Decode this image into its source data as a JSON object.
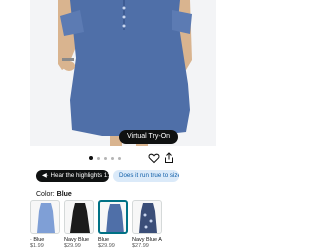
{
  "product": {
    "virtual_tryon_label": "Virtual Try-On",
    "image_count": 5,
    "active_image": 1
  },
  "actions": {
    "highlights_label": "◀· Hear the highlights 1:59",
    "fit_label": "Does it run true to size?"
  },
  "color": {
    "label": "Color:",
    "selected": "Blue"
  },
  "swatches": [
    {
      "name": "· Blue",
      "price": "$1.99",
      "color": "#7f9fd6"
    },
    {
      "name": "Navy Blue",
      "price": "$29.99",
      "color": "#1b1b1b"
    },
    {
      "name": "Blue",
      "price": "$29.99",
      "color": "#4f6fa8"
    },
    {
      "name": "Navy Blue A...",
      "price": "$27.99",
      "color": "#3b4e78"
    }
  ],
  "colors": {
    "dress": "#4f6fa8",
    "accent": "#007185"
  }
}
